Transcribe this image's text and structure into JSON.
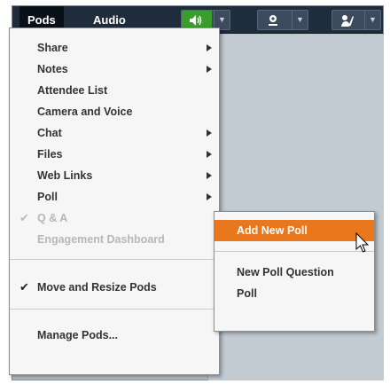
{
  "menubar": {
    "pods_label": "Pods",
    "audio_label": "Audio",
    "tools": [
      {
        "name": "speaker-icon",
        "active_color": "#3a9e2a"
      },
      {
        "name": "camera-icon"
      },
      {
        "name": "raise-hand-icon"
      }
    ]
  },
  "pods_menu": {
    "items": [
      {
        "label": "Share",
        "submenu": true
      },
      {
        "label": "Notes",
        "submenu": true
      },
      {
        "label": "Attendee List",
        "submenu": false
      },
      {
        "label": "Camera and Voice",
        "submenu": false
      },
      {
        "label": "Chat",
        "submenu": true
      },
      {
        "label": "Files",
        "submenu": true
      },
      {
        "label": "Web Links",
        "submenu": true
      },
      {
        "label": "Poll",
        "submenu": true
      },
      {
        "label": "Q & A",
        "checked": true,
        "disabled": true
      },
      {
        "label": "Engagement Dashboard",
        "disabled": true
      },
      {
        "label": "Move and Resize Pods",
        "checked": true
      },
      {
        "label": "Manage Pods..."
      }
    ]
  },
  "poll_submenu": {
    "items": [
      {
        "label": "Add New Poll",
        "highlighted": true
      },
      {
        "label": "New Poll Question"
      },
      {
        "label": "Poll"
      }
    ]
  },
  "colors": {
    "menubar_bg": "#1f2c3b",
    "highlight": "#e9771e"
  }
}
